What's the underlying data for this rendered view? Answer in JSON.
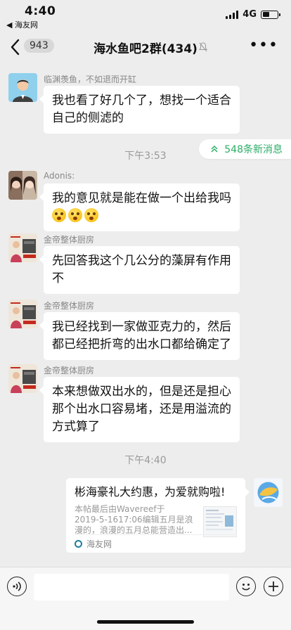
{
  "status_bar": {
    "time": "4:40",
    "back_app": "◀ 海友网",
    "network": "4G"
  },
  "nav": {
    "unread_count": "943",
    "title": "海水鱼吧2群(434)",
    "more_icon": "ellipsis-icon",
    "mute_icon": "bell-off-icon"
  },
  "new_messages": "548条新消息",
  "messages": [
    {
      "sender": "临渊羡鱼，不如退而开缸",
      "text": [
        "我也看了好几个了，想找一个适合",
        "自己的侧滤的"
      ]
    },
    {
      "sender": "Adonis:",
      "text": [
        "我的意见就是能在做一个出给我吗"
      ],
      "emoji_count": 3
    },
    {
      "sender": "金帝整体厨房",
      "text": [
        "先回答我这个几公分的藻屏有作用",
        "不"
      ]
    },
    {
      "sender": "金帝整体厨房",
      "text": [
        "我已经找到一家做亚克力的，然后",
        "都已经把折弯的出水口都给确定了"
      ]
    },
    {
      "sender": "金帝整体厨房",
      "text": [
        "本来想做双出水的，但是还是担心",
        "那个出水口容易堵，还是用溢流的",
        "方式算了"
      ]
    }
  ],
  "timestamps": [
    "下午3:53",
    "下午4:40"
  ],
  "link_card": {
    "title": "彬海豪礼大约惠，为爱就购啦!",
    "description": [
      "本帖最后由Wavereef于",
      "2019-5-1617:06编辑五月是浪",
      "漫的，浪漫的五月总能营造出..."
    ],
    "source": "海友网"
  },
  "colors": {
    "background": "#ededed",
    "accent_green": "#2aae67",
    "bubble": "#ffffff"
  }
}
